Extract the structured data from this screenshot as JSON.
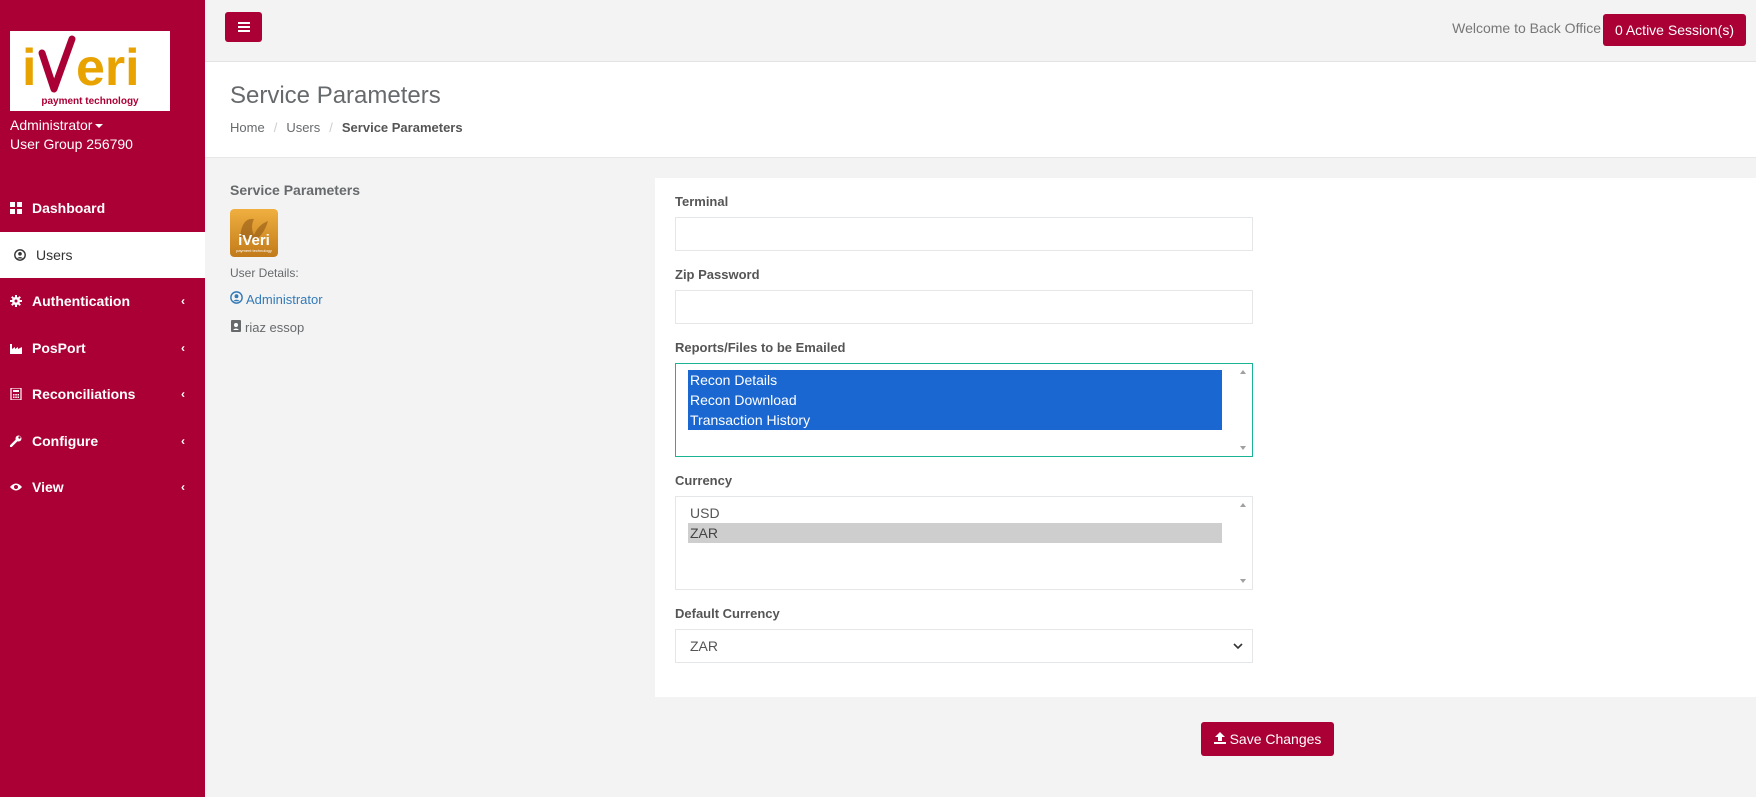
{
  "brand": {
    "logo_text": "iveri",
    "logo_tagline": "payment technology",
    "primary_color": "#ab0035"
  },
  "sidebar": {
    "user_name": "Administrator",
    "user_group": "User Group 256790",
    "items": [
      {
        "label": "Dashboard",
        "icon": "dashboard-icon",
        "active": false,
        "has_chevron": false
      },
      {
        "label": "Users",
        "icon": "user-circle-icon",
        "active": true,
        "has_chevron": false
      },
      {
        "label": "Authentication",
        "icon": "gear-icon",
        "active": false,
        "has_chevron": true
      },
      {
        "label": "PosPort",
        "icon": "industry-icon",
        "active": false,
        "has_chevron": true
      },
      {
        "label": "Reconciliations",
        "icon": "calculator-icon",
        "active": false,
        "has_chevron": true
      },
      {
        "label": "Configure",
        "icon": "wrench-icon",
        "active": false,
        "has_chevron": true
      },
      {
        "label": "View",
        "icon": "eye-icon",
        "active": false,
        "has_chevron": true
      }
    ]
  },
  "topbar": {
    "welcome_text": "Welcome to Back Office",
    "sessions_label": "0 Active Session(s)"
  },
  "header": {
    "title": "Service Parameters",
    "breadcrumb": [
      "Home",
      "Users",
      "Service Parameters"
    ]
  },
  "info_panel": {
    "title": "Service Parameters",
    "user_details_label": "User Details:",
    "user_link": "Administrator",
    "user_full_name": "riaz essop"
  },
  "form": {
    "terminal": {
      "label": "Terminal",
      "value": ""
    },
    "zip_password": {
      "label": "Zip Password",
      "value": ""
    },
    "reports": {
      "label": "Reports/Files to be Emailed",
      "options": [
        "Recon Details",
        "Recon Download",
        "Transaction History"
      ],
      "selected": [
        "Recon Details",
        "Recon Download",
        "Transaction History"
      ]
    },
    "currency": {
      "label": "Currency",
      "options": [
        "USD",
        "ZAR"
      ],
      "selected": [
        "ZAR"
      ]
    },
    "default_currency": {
      "label": "Default Currency",
      "value": "ZAR"
    }
  },
  "actions": {
    "save_label": "Save Changes"
  }
}
